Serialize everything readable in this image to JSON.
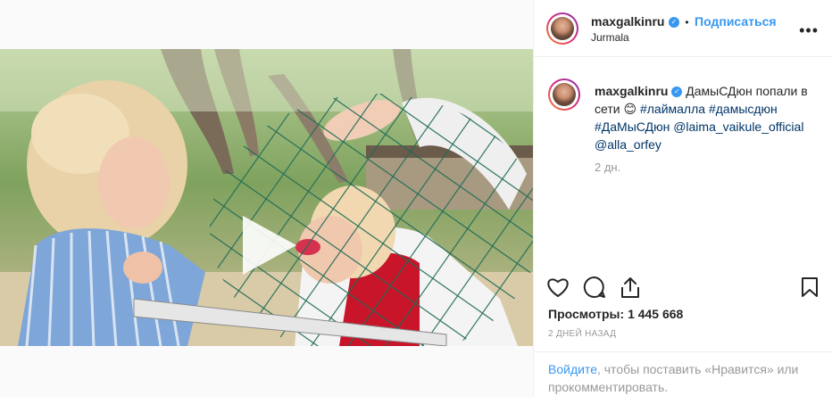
{
  "post": {
    "username": "maxgalkinru",
    "verified_mark": "✓",
    "separator": "•",
    "follow_label": "Подписаться",
    "location": "Jurmala",
    "more_label": "•••"
  },
  "caption": {
    "username": "maxgalkinru",
    "text_1": "ДамыСДюн попали в сети",
    "emoji": "😊",
    "hashtags": [
      "#лаймалла",
      "#дамысдюн",
      "#ДаМыСДюн"
    ],
    "mentions": [
      "@laima_vaikule_official",
      "@alla_orfey"
    ],
    "time": "2 дн."
  },
  "stats": {
    "views_label": "Просмотры:",
    "views_value": "1 445 668",
    "ago": "2 ДНЕЙ НАЗАД"
  },
  "footer": {
    "login_link": "Войдите",
    "rest": ", чтобы поставить «Нравится» или прокомментировать."
  },
  "icons": {
    "like": "heart-icon",
    "comment": "comment-icon",
    "share": "share-icon",
    "save": "bookmark-icon",
    "play": "play-icon"
  }
}
